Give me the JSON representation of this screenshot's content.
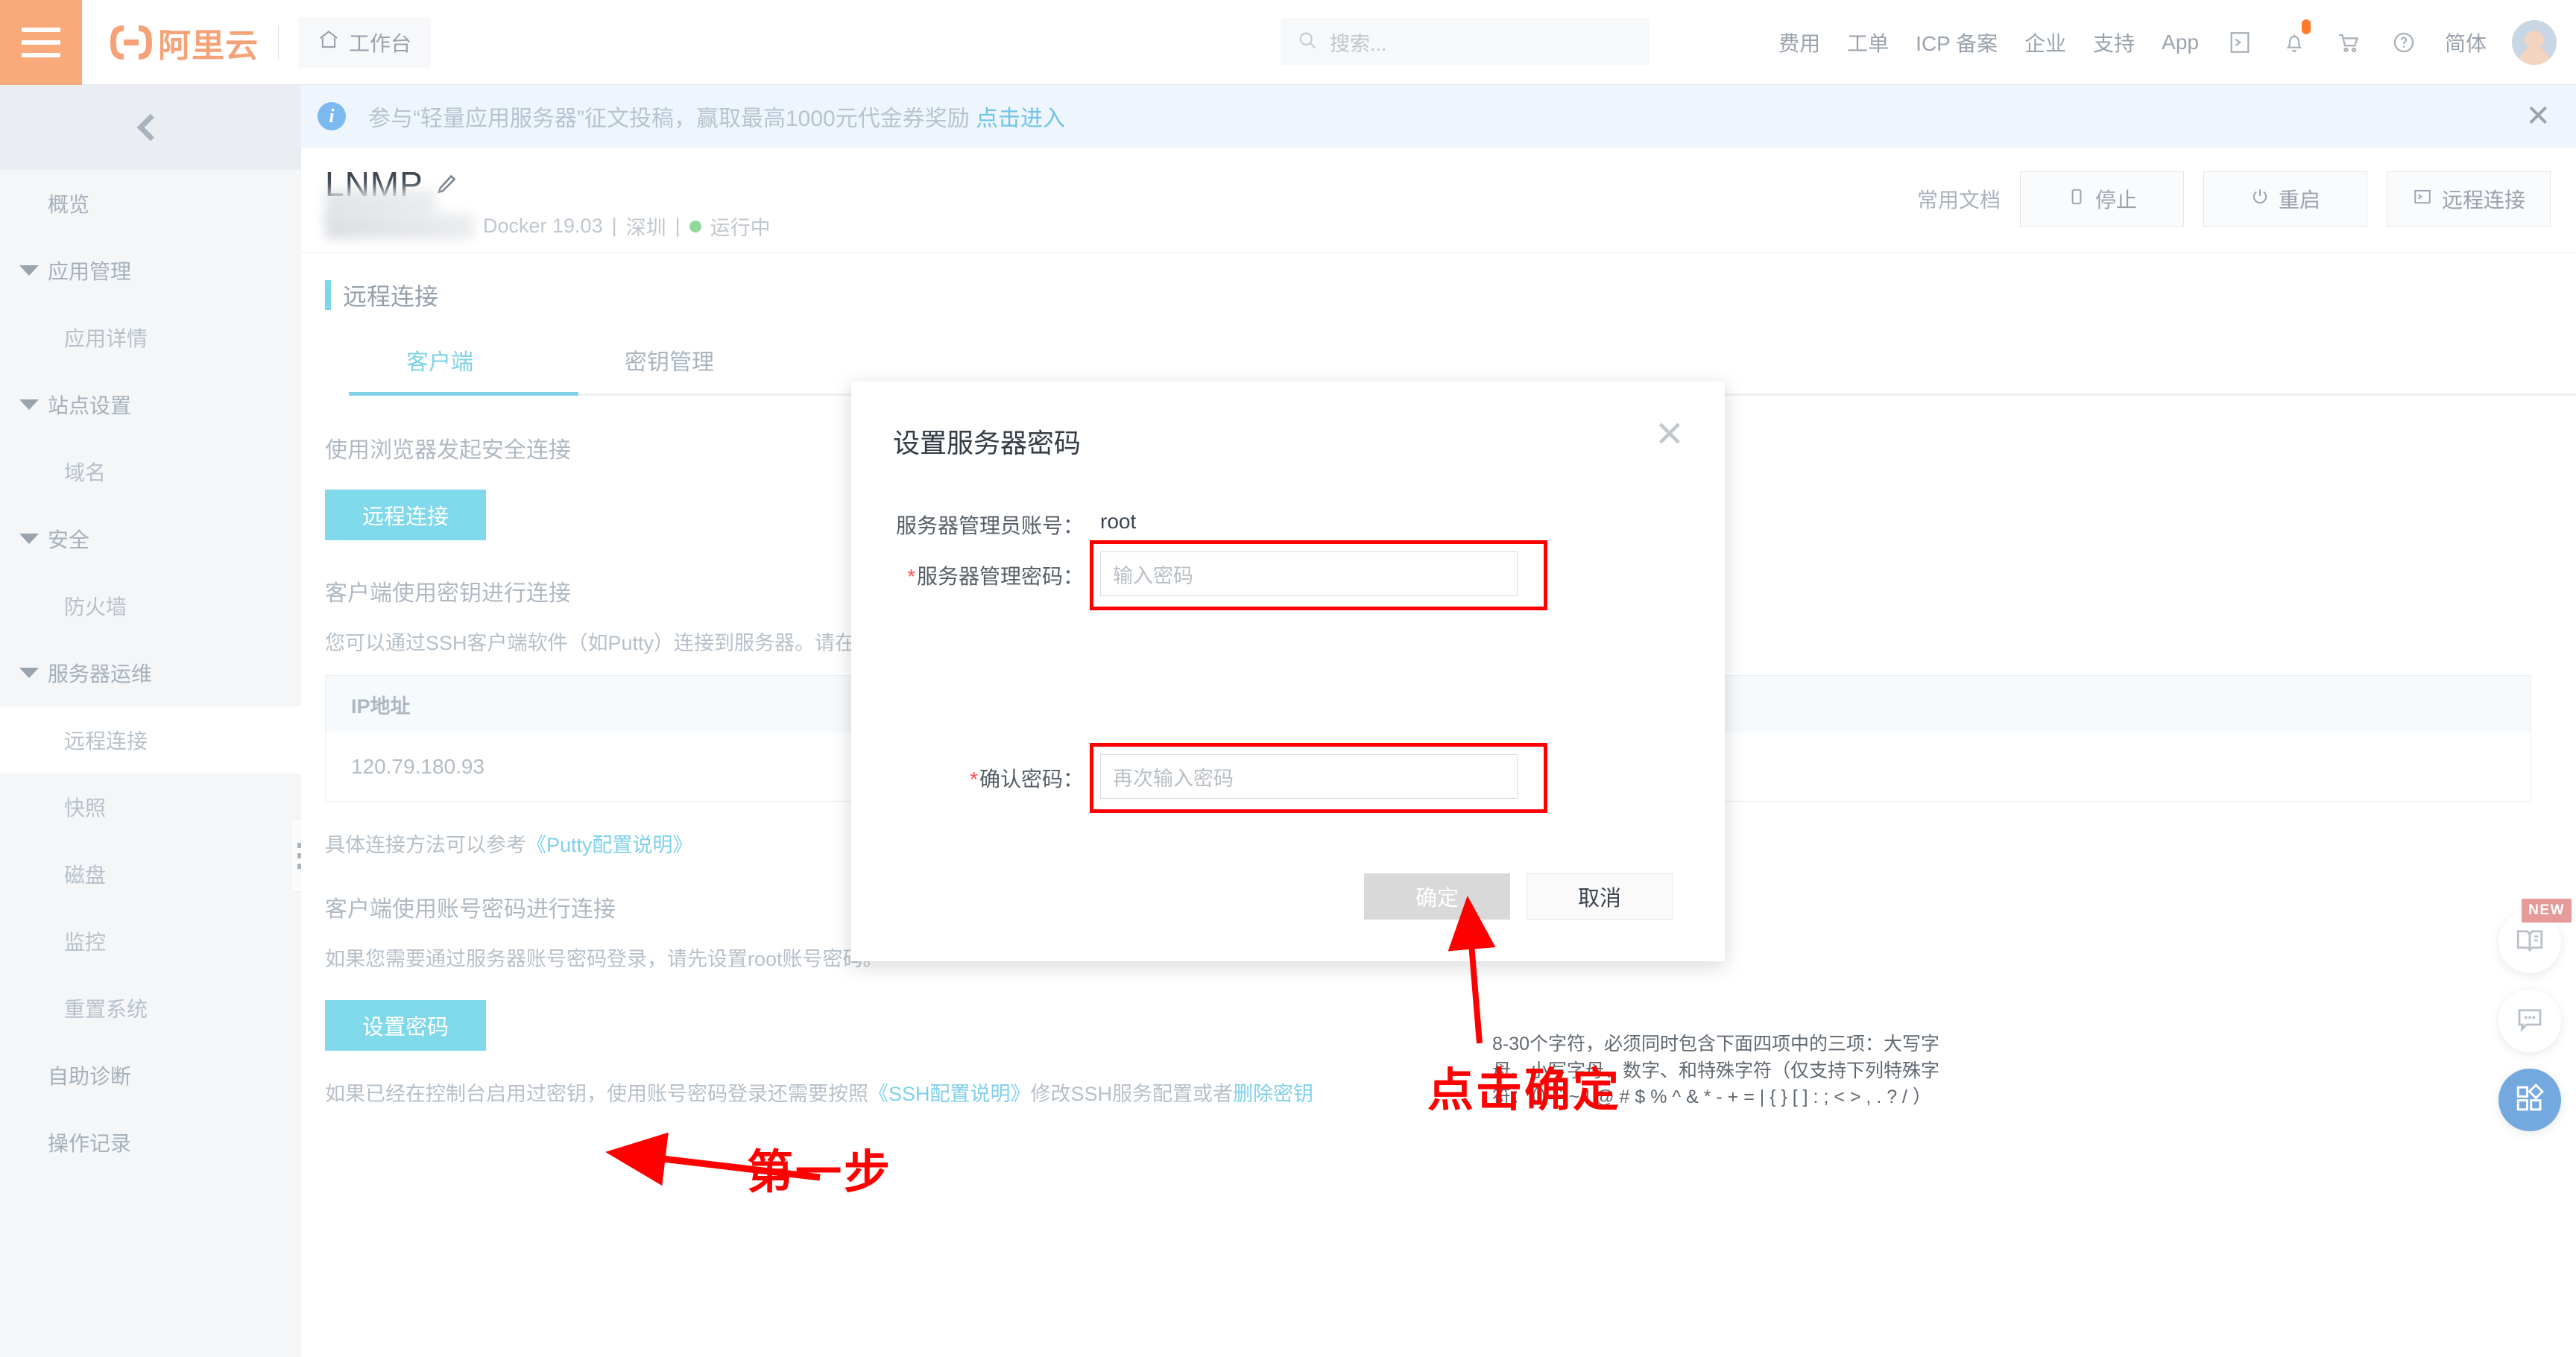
{
  "header": {
    "logo_text": "阿里云",
    "workbench_label": "工作台",
    "search_placeholder": "搜索...",
    "nav_items": [
      {
        "label": "费用"
      },
      {
        "label": "工单"
      },
      {
        "label": "ICP 备案"
      },
      {
        "label": "企业"
      },
      {
        "label": "支持"
      },
      {
        "label": "App"
      }
    ],
    "lang_label": "简体"
  },
  "banner": {
    "text": "参与“轻量应用服务器”征文投稿，赢取最高1000元代金券奖励",
    "link": "点击进入",
    "close": "✕"
  },
  "sidebar": {
    "items": [
      {
        "label": "概览",
        "level": 1,
        "group": false,
        "active": false
      },
      {
        "label": "应用管理",
        "level": 1,
        "group": true,
        "active": false
      },
      {
        "label": "应用详情",
        "level": 2,
        "group": false,
        "active": false
      },
      {
        "label": "站点设置",
        "level": 1,
        "group": true,
        "active": false
      },
      {
        "label": "域名",
        "level": 2,
        "group": false,
        "active": false
      },
      {
        "label": "安全",
        "level": 1,
        "group": true,
        "active": false
      },
      {
        "label": "防火墙",
        "level": 2,
        "group": false,
        "active": false
      },
      {
        "label": "服务器运维",
        "level": 1,
        "group": true,
        "active": false
      },
      {
        "label": "远程连接",
        "level": 2,
        "group": false,
        "active": true
      },
      {
        "label": "快照",
        "level": 2,
        "group": false,
        "active": false
      },
      {
        "label": "磁盘",
        "level": 2,
        "group": false,
        "active": false
      },
      {
        "label": "监控",
        "level": 2,
        "group": false,
        "active": false
      },
      {
        "label": "重置系统",
        "level": 2,
        "group": false,
        "active": false
      },
      {
        "label": "自助诊断",
        "level": 1,
        "group": false,
        "active": false
      },
      {
        "label": "操作记录",
        "level": 1,
        "group": false,
        "active": false
      }
    ]
  },
  "page": {
    "title": "LNMP",
    "sub_docker": "Docker 19.03",
    "sub_region": "深圳",
    "sub_status": "运行中",
    "sep": "|",
    "doc_link": "常用文档",
    "actions": [
      {
        "label": "停止",
        "icon": "stop-icon"
      },
      {
        "label": "重启",
        "icon": "power-icon"
      },
      {
        "label": "远程连接",
        "icon": "terminal-icon"
      }
    ]
  },
  "section": {
    "title": "远程连接",
    "tabs": [
      {
        "label": "客户端",
        "active": true
      },
      {
        "label": "密钥管理",
        "active": false
      }
    ]
  },
  "content": {
    "heading_browser": "使用浏览器发起安全连接",
    "btn_remote_connect": "远程连接",
    "heading_key": "客户端使用密钥进行连接",
    "desc_ssh": "您可以通过SSH客户端软件（如Putty）连接到服务器。请在",
    "table_header": "IP地址",
    "table_ip": "120.79.180.93",
    "putty_prefix": "具体连接方法可以参考",
    "putty_link": "《Putty配置说明》",
    "heading_account": "客户端使用账号密码进行连接",
    "desc_account": "如果您需要通过服务器账号密码登录，请先设置root账号密码。",
    "btn_set_password": "设置密码",
    "footer_prefix": "如果已经在控制台启用过密钥，使用账号密码登录还需要按照",
    "footer_link1": "《SSH配置说明》",
    "footer_mid": "修改SSH服务配置或者",
    "footer_link2": "删除密钥"
  },
  "modal": {
    "title": "设置服务器密码",
    "close": "✕",
    "account_label": "服务器管理员账号：",
    "account_value": "root",
    "password_label": "服务器管理密码：",
    "password_placeholder": "输入密码",
    "password_hint": "8-30个字符，必须同时包含下面四项中的三项：大写字母、小写字母、数字、和特殊字符（仅支持下列特殊字符：（）` ~ ! @ # $ % ^ & * - + = | { } [ ] : ; < > , . ? / ）",
    "confirm_label": "确认密码：",
    "confirm_placeholder": "再次输入密码",
    "btn_ok": "确定",
    "btn_cancel": "取消",
    "required_mark": "*"
  },
  "annotations": {
    "step_one": "第一步",
    "click_ok": "点击确定",
    "color": "#ff0000"
  },
  "float_buttons": {
    "new_badge": "NEW",
    "items": [
      {
        "name": "docs-icon"
      },
      {
        "name": "chat-icon"
      },
      {
        "name": "apps-icon"
      }
    ]
  },
  "colors": {
    "brand_orange": "#f9a97a",
    "accent_cyan": "#7fd9ea",
    "status_green": "#8fd99a",
    "annotation_red": "#ff0000"
  }
}
